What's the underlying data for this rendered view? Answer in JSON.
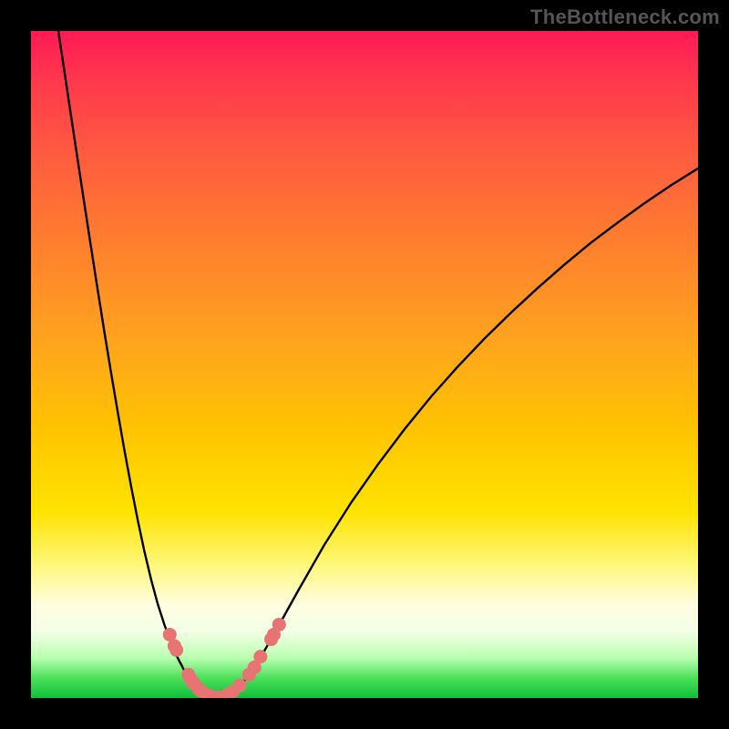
{
  "watermark": "TheBottleneck.com",
  "chart_data": {
    "type": "line",
    "title": "",
    "xlabel": "",
    "ylabel": "",
    "xlim": [
      0,
      100
    ],
    "ylim": [
      0,
      100
    ],
    "series": [
      {
        "name": "left-curve",
        "x": [
          4.1,
          5.0,
          6.0,
          7.0,
          8.0,
          9.0,
          10.0,
          11.0,
          12.0,
          13.0,
          14.0,
          15.0,
          16.0,
          17.0,
          18.0,
          19.0,
          20.0,
          21.0,
          22.0,
          23.0,
          24.0,
          25.0,
          26.0,
          27.0,
          27.73
        ],
        "y": [
          100.0,
          94.0,
          87.3,
          80.7,
          74.1,
          67.6,
          61.2,
          54.9,
          48.8,
          42.9,
          37.2,
          31.8,
          26.7,
          22.0,
          17.8,
          14.1,
          11.0,
          8.3,
          6.0,
          4.1,
          2.6,
          1.5,
          0.7,
          0.2,
          0.0
        ]
      },
      {
        "name": "right-curve",
        "x": [
          27.73,
          29.0,
          30.0,
          32.0,
          34.0,
          36.0,
          38.0,
          40.0,
          44.0,
          48.0,
          52.0,
          56.0,
          60.0,
          64.0,
          68.0,
          72.0,
          76.0,
          80.0,
          84.0,
          88.0,
          92.0,
          96.0,
          100.0
        ],
        "y": [
          0.0,
          0.3,
          0.8,
          2.6,
          5.4,
          8.8,
          12.4,
          16.0,
          23.0,
          29.3,
          35.0,
          40.3,
          45.2,
          49.7,
          53.9,
          57.8,
          61.5,
          65.0,
          68.3,
          71.3,
          74.2,
          76.9,
          79.4
        ]
      }
    ],
    "markers": [
      {
        "series": "left-curve",
        "x": 20.8,
        "y": 9.5
      },
      {
        "series": "left-curve",
        "x": 21.5,
        "y": 7.8
      },
      {
        "series": "left-curve",
        "x": 21.8,
        "y": 7.2
      },
      {
        "series": "left-curve",
        "x": 23.6,
        "y": 3.5
      },
      {
        "series": "left-curve",
        "x": 23.9,
        "y": 2.9
      },
      {
        "series": "left-curve",
        "x": 24.3,
        "y": 2.3
      },
      {
        "series": "left-curve",
        "x": 25.0,
        "y": 1.5
      },
      {
        "series": "left-curve",
        "x": 25.4,
        "y": 1.1
      },
      {
        "series": "left-curve",
        "x": 26.4,
        "y": 0.5
      },
      {
        "series": "left-curve",
        "x": 27.0,
        "y": 0.2
      },
      {
        "series": "left-curve",
        "x": 28.0,
        "y": 0.1
      },
      {
        "series": "right-curve",
        "x": 29.5,
        "y": 0.5
      },
      {
        "series": "right-curve",
        "x": 30.3,
        "y": 1.0
      },
      {
        "series": "right-curve",
        "x": 31.3,
        "y": 1.9
      },
      {
        "series": "right-curve",
        "x": 32.7,
        "y": 3.5
      },
      {
        "series": "right-curve",
        "x": 33.5,
        "y": 4.6
      },
      {
        "series": "right-curve",
        "x": 34.4,
        "y": 6.2
      },
      {
        "series": "right-curve",
        "x": 36.0,
        "y": 8.8
      },
      {
        "series": "right-curve",
        "x": 36.4,
        "y": 9.5
      },
      {
        "series": "right-curve",
        "x": 37.2,
        "y": 11.0
      }
    ],
    "marker_color": "#e77373",
    "curve_color": "#000000"
  }
}
